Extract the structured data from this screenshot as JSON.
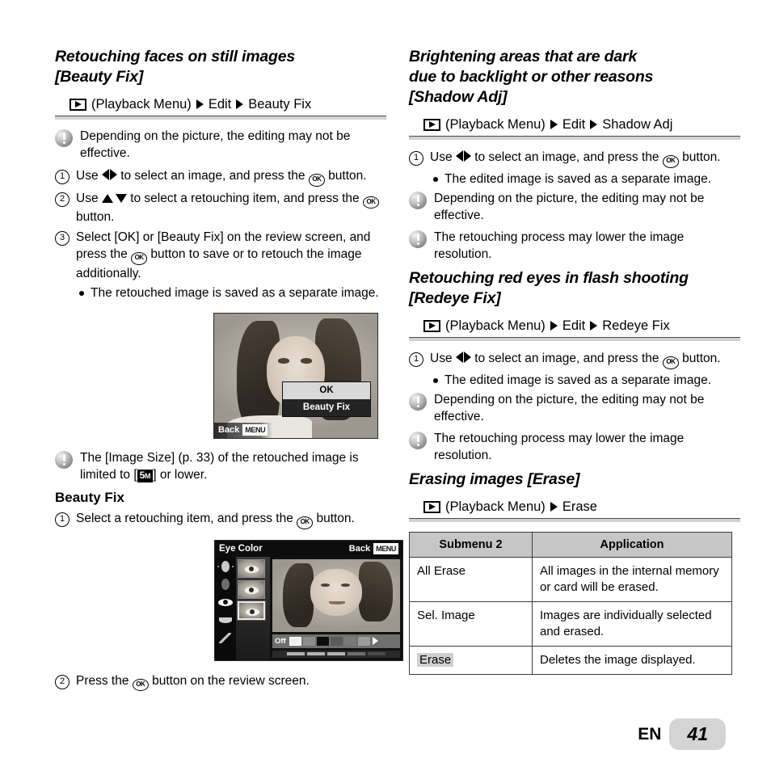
{
  "left_column": {
    "section1": {
      "title_line1": "Retouching faces on still images",
      "title_line2": "[Beauty Fix]",
      "path": {
        "menu_label": "(Playback Menu)",
        "step1": "Edit",
        "step2": "Beauty Fix"
      },
      "note1": "Depending on the picture, the editing may not be effective.",
      "step1_pre": "Use",
      "step1_mid": "to select an image, and press the",
      "step1_post": "button.",
      "step2_pre": "Use",
      "step2_mid": "to select a retouching item, and press the",
      "step2_post": "button.",
      "step3_a": "Select [OK] or [Beauty Fix] on the review screen, and press the",
      "step3_b": "button to save or to retouch the image additionally.",
      "bullet1": "The retouched image is saved as a separate image.",
      "note2_a": "The [Image Size] (p. 33) of the retouched image is limited to [",
      "note2_badge_num": "5",
      "note2_badge_unit": "M",
      "note2_b": "] or lower."
    },
    "review_screen": {
      "option_ok": "OK",
      "option_beauty_fix": "Beauty Fix",
      "back_label": "Back",
      "menu_badge": "MENU"
    },
    "section2": {
      "title": "Beauty Fix",
      "step1_pre": "Select a retouching item, and press the",
      "step1_post": "button.",
      "step2_pre": "Press the",
      "step2_post": "button on the review screen."
    },
    "editor_screen": {
      "title": "Eye Color",
      "back_label": "Back",
      "menu_badge": "MENU",
      "swatch_off_label": "Off"
    }
  },
  "right_column": {
    "section1": {
      "title_line1": "Brightening areas that are dark",
      "title_line2": "due to backlight or other reasons",
      "title_line3": "[Shadow Adj]",
      "path": {
        "menu_label": "(Playback Menu)",
        "step1": "Edit",
        "step2": "Shadow Adj"
      },
      "step1_pre": "Use",
      "step1_mid": "to select an image, and press the",
      "step1_post": "button.",
      "bullet1": "The edited image is saved as a separate image.",
      "note1": "Depending on the picture, the editing may not be effective.",
      "note2": "The retouching process may lower the image resolution."
    },
    "section2": {
      "title_line1": "Retouching red eyes in flash shooting",
      "title_line2": "[Redeye Fix]",
      "path": {
        "menu_label": "(Playback Menu)",
        "step1": "Edit",
        "step2": "Redeye Fix"
      },
      "step1_pre": "Use",
      "step1_mid": "to select an image, and press the",
      "step1_post": "button.",
      "bullet1": "The edited image is saved as a separate image.",
      "note1": "Depending on the picture, the editing may not be effective.",
      "note2": "The retouching process may lower the image resolution."
    },
    "section3": {
      "title": "Erasing images [Erase]",
      "path": {
        "menu_label": "(Playback Menu)",
        "step1": "Erase"
      },
      "table": {
        "headers": [
          "Submenu 2",
          "Application"
        ],
        "rows": [
          {
            "submenu": "All Erase",
            "application": "All images in the internal memory or card will be erased.",
            "highlight": false
          },
          {
            "submenu": "Sel. Image",
            "application": "Images are individually selected and erased.",
            "highlight": false
          },
          {
            "submenu": "Erase",
            "application": "Deletes the image displayed.",
            "highlight": true
          }
        ]
      }
    }
  },
  "footer": {
    "language": "EN",
    "page_number": "41"
  }
}
